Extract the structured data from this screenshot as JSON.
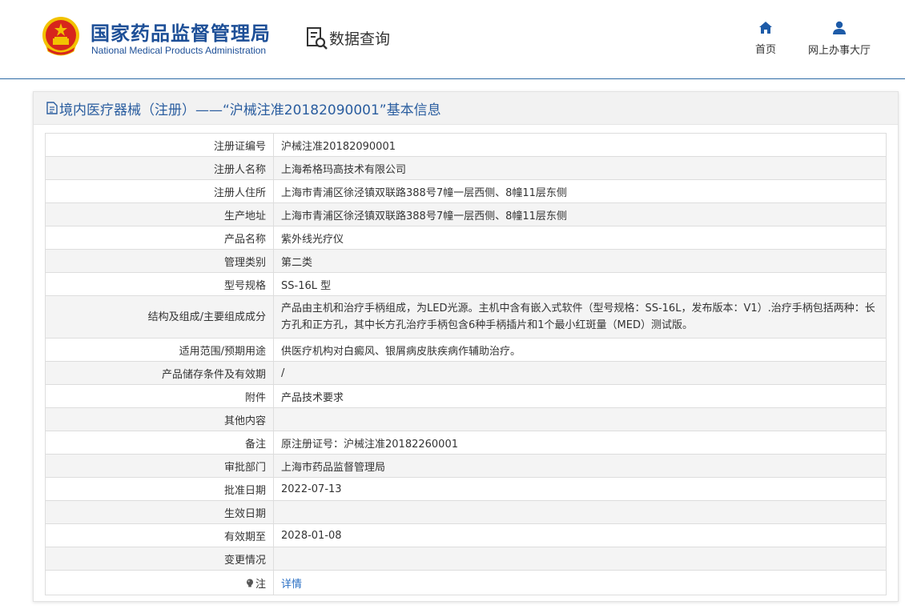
{
  "header": {
    "title_cn": "国家药品监督管理局",
    "title_en": "National Medical Products Administration",
    "query_label": "数据查询",
    "nav": [
      {
        "label": "首页",
        "icon": "home-icon"
      },
      {
        "label": "网上办事大厅",
        "icon": "user-icon"
      }
    ]
  },
  "panel": {
    "title": "境内医疗器械（注册）——“沪械注准20182090001”基本信息"
  },
  "rows": [
    {
      "label": "注册证编号",
      "value": "沪械注准20182090001"
    },
    {
      "label": "注册人名称",
      "value": "上海希格玛高技术有限公司"
    },
    {
      "label": "注册人住所",
      "value": "上海市青浦区徐泾镇双联路388号7幢一层西侧、8幢11层东侧"
    },
    {
      "label": "生产地址",
      "value": "上海市青浦区徐泾镇双联路388号7幢一层西侧、8幢11层东侧"
    },
    {
      "label": "产品名称",
      "value": "紫外线光疗仪"
    },
    {
      "label": "管理类别",
      "value": "第二类"
    },
    {
      "label": "型号规格",
      "value": "SS-16L 型"
    },
    {
      "label": "结构及组成/主要组成成分",
      "value": "产品由主机和治疗手柄组成，为LED光源。主机中含有嵌入式软件（型号规格：SS-16L，发布版本：V1）.治疗手柄包括两种：长方孔和正方孔，其中长方孔治疗手柄包含6种手柄插片和1个最小红斑量（MED）测试版。"
    },
    {
      "label": "适用范围/预期用途",
      "value": "供医疗机构对白癜风、银屑病皮肤疾病作辅助治疗。"
    },
    {
      "label": "产品储存条件及有效期",
      "value": "/"
    },
    {
      "label": "附件",
      "value": "产品技术要求"
    },
    {
      "label": "其他内容",
      "value": ""
    },
    {
      "label": "备注",
      "value": "原注册证号：沪械注准20182260001"
    },
    {
      "label": "审批部门",
      "value": "上海市药品监督管理局"
    },
    {
      "label": "批准日期",
      "value": "2022-07-13"
    },
    {
      "label": "生效日期",
      "value": ""
    },
    {
      "label": "有效期至",
      "value": "2028-01-08"
    },
    {
      "label": "变更情况",
      "value": ""
    },
    {
      "label": "注",
      "value": "详情"
    }
  ],
  "colors": {
    "brand_blue": "#1d4f97",
    "link_blue": "#2a6fc4",
    "emblem_red": "#d7261c",
    "emblem_gold": "#f2c200"
  }
}
